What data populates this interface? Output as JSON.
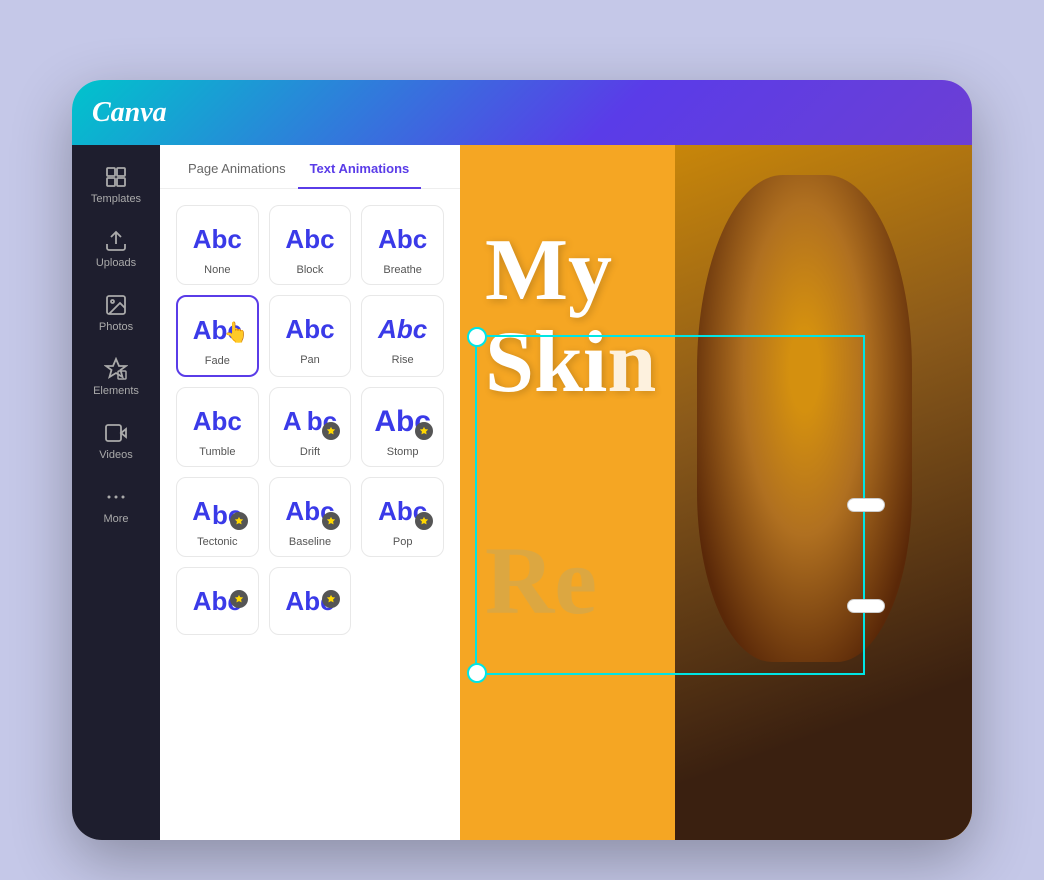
{
  "app": {
    "logo": "Canva"
  },
  "sidebar": {
    "items": [
      {
        "id": "templates",
        "label": "Templates"
      },
      {
        "id": "uploads",
        "label": "Uploads"
      },
      {
        "id": "photos",
        "label": "Photos"
      },
      {
        "id": "elements",
        "label": "Elements"
      },
      {
        "id": "videos",
        "label": "Videos"
      },
      {
        "id": "more",
        "label": "More"
      }
    ]
  },
  "panel": {
    "tabs": [
      {
        "id": "page-animations",
        "label": "Page Animations"
      },
      {
        "id": "text-animations",
        "label": "Text Animations",
        "active": true
      }
    ],
    "animations": [
      {
        "id": "none",
        "label": "None",
        "abc": "Abc",
        "selected": false,
        "pro": false
      },
      {
        "id": "block",
        "label": "Block",
        "abc": "Abc",
        "selected": false,
        "pro": false
      },
      {
        "id": "breathe",
        "label": "Breathe",
        "abc": "Abc",
        "selected": false,
        "pro": false
      },
      {
        "id": "fade",
        "label": "Fade",
        "abc": "Abc",
        "selected": true,
        "pro": false
      },
      {
        "id": "pan",
        "label": "Pan",
        "abc": "Abc",
        "selected": false,
        "pro": false
      },
      {
        "id": "rise",
        "label": "Rise",
        "abc": "Abc",
        "selected": false,
        "pro": false
      },
      {
        "id": "tumble",
        "label": "Tumble",
        "abc": "Abc",
        "selected": false,
        "pro": false
      },
      {
        "id": "drift",
        "label": "Drift",
        "abc": "A bc",
        "selected": false,
        "pro": true
      },
      {
        "id": "stomp",
        "label": "Stomp",
        "abc": "Abc",
        "selected": false,
        "pro": true
      },
      {
        "id": "tectonic",
        "label": "Tectonic",
        "abc": "A bc",
        "selected": false,
        "pro": true
      },
      {
        "id": "baseline",
        "label": "Baseline",
        "abc": "Abc",
        "selected": false,
        "pro": true
      },
      {
        "id": "pop",
        "label": "Pop",
        "abc": "Abc",
        "selected": false,
        "pro": true
      },
      {
        "id": "extra1",
        "label": "",
        "abc": "Abc",
        "selected": false,
        "pro": true
      },
      {
        "id": "extra2",
        "label": "",
        "abc": "Abc",
        "selected": false,
        "pro": true
      }
    ]
  },
  "canvas": {
    "text_my": "My",
    "text_skin": "Skin",
    "text_re": "Re"
  },
  "colors": {
    "accent": "#5a3ce8",
    "teal": "#00e5e5",
    "orange": "#f5a623"
  }
}
